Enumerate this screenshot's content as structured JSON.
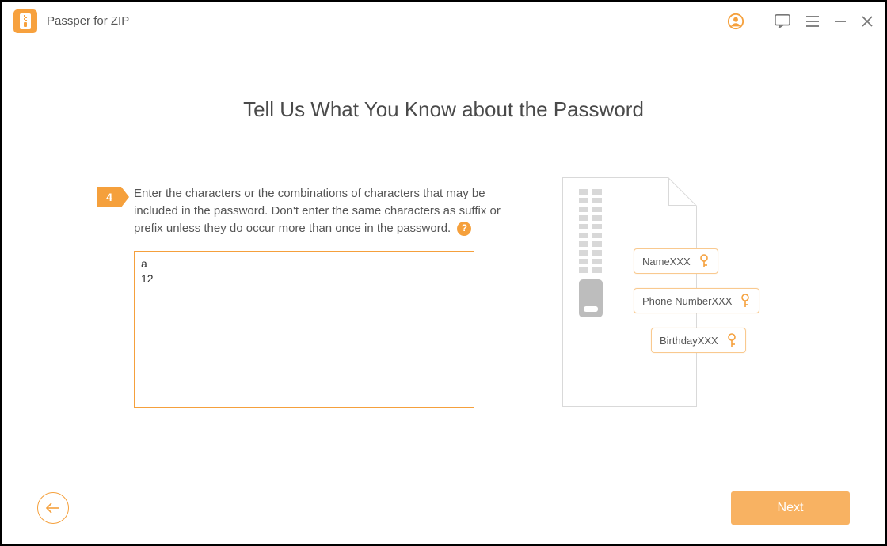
{
  "app": {
    "title": "Passper for ZIP"
  },
  "heading": "Tell Us What You Know about the Password",
  "step": {
    "number": "4",
    "text": "Enter the characters or the combinations of characters that may be included in the password. Don't enter the same characters as suffix or prefix unless they do occur more than once in the password.",
    "help": "?"
  },
  "input": {
    "value": "a\n12"
  },
  "illustration": {
    "hints": [
      "NameXXX",
      "Phone NumberXXX",
      "BirthdayXXX"
    ]
  },
  "footer": {
    "next": "Next"
  }
}
